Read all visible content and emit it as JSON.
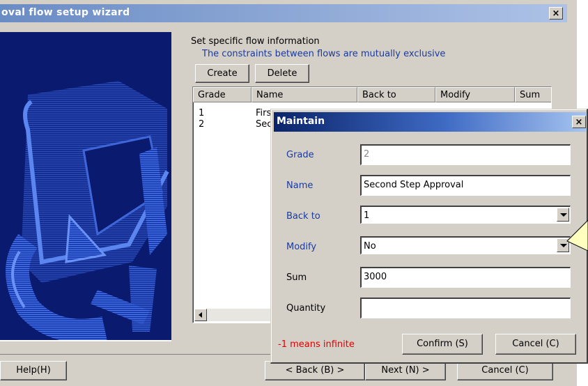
{
  "wizard": {
    "title": "oval flow setup wizard",
    "close_label": "×",
    "heading": "Set specific flow information",
    "subheading": "The constraints between flows are mutually exclusive",
    "create_label": "Create",
    "delete_label": "Delete",
    "columns": [
      "Grade",
      "Name",
      "Back to",
      "Modify",
      "Sum"
    ],
    "rows": [
      {
        "grade": "1",
        "name": "Firs"
      },
      {
        "grade": "2",
        "name": "Sec"
      }
    ],
    "help_label": "Help(H)",
    "back_label": "< Back (B) >",
    "next_label": "Next (N) >",
    "cancel_label": "Cancel (C)"
  },
  "dialog": {
    "title": "Maintain",
    "close_label": "×",
    "grade_label": "Grade",
    "grade_value": "2",
    "name_label": "Name",
    "name_value": "Second Step Approval",
    "backto_label": "Back to",
    "backto_value": "1",
    "modify_label": "Modify",
    "modify_value": "No",
    "sum_label": "Sum",
    "sum_value": "3000",
    "quantity_label": "Quantity",
    "quantity_value": "",
    "hint": "-1 means infinite",
    "confirm_label": "Confirm (S)",
    "cancel_label": "Cancel (C)"
  },
  "colors": {
    "titlebar_start": "#6a8cc4",
    "titlebar_end": "#aec2e6",
    "dialog_titlebar": "#0a246a",
    "illustration_bg": "#0b1f7a",
    "hint": "#e00000",
    "label_blue": "#1a3a9e",
    "callout": "#ffffc0"
  }
}
